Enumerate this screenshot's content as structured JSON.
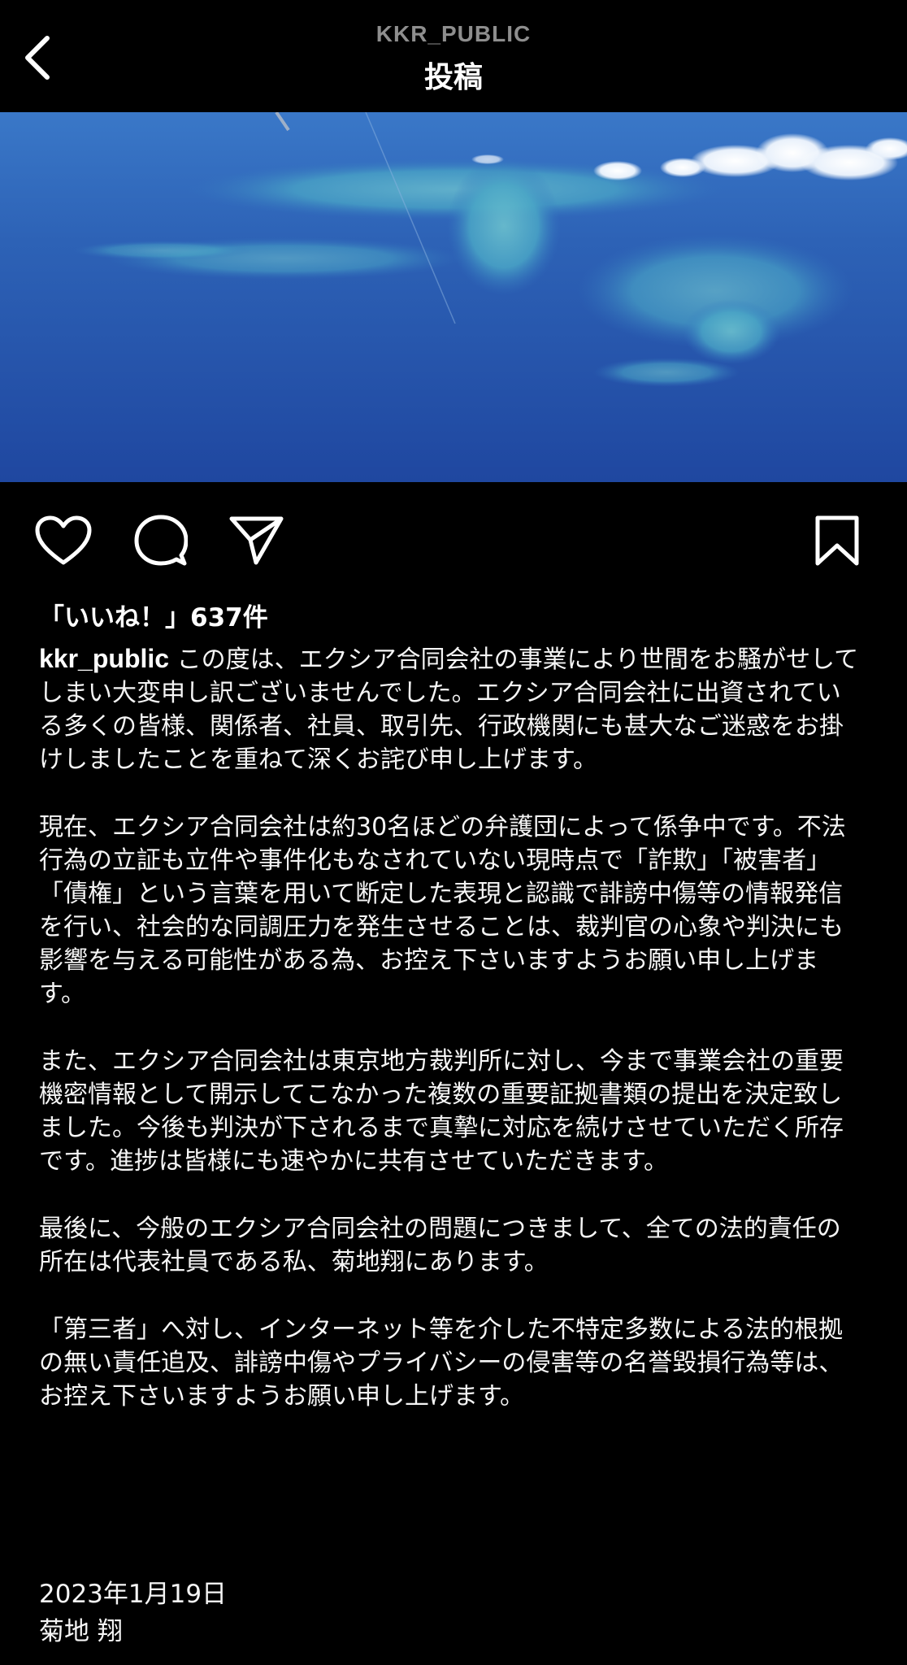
{
  "header": {
    "back_icon": "chevron-left-icon",
    "username": "KKR_PUBLIC",
    "title": "投稿"
  },
  "post": {
    "image_description_icon": "photo",
    "actions": {
      "like_icon": "heart-icon",
      "comment_icon": "comment-icon",
      "share_icon": "paper-plane-icon",
      "save_icon": "bookmark-icon"
    },
    "likes_text": "「いいね！」637件",
    "caption_user": "kkr_public",
    "caption_paragraphs": [
      "この度は、エクシア合同会社の事業により世間をお騒がせしてしまい大変申し訳ございませんでした。エクシア合同会社に出資されている多くの皆様、関係者、社員、取引先、行政機関にも甚大なご迷惑をお掛けしましたことを重ねて深くお詫び申し上げます。",
      "現在、エクシア合同会社は約30名ほどの弁護団によって係争中です。不法行為の立証も立件や事件化もなされていない現時点で「詐欺」「被害者」「債権」という言葉を用いて断定した表現と認識で誹謗中傷等の情報発信を行い、社会的な同調圧力を発生させることは、裁判官の心象や判決にも影響を与える可能性がある為、お控え下さいますようお願い申し上げます。",
      "また、エクシア合同会社は東京地方裁判所に対し、今まで事業会社の重要機密情報として開示してこなかった複数の重要証拠書類の提出を決定致しました。今後も判決が下されるまで真摯に対応を続けさせていただく所存です。進捗は皆様にも速やかに共有させていただきます。",
      "最後に、今般のエクシア合同会社の問題につきまして、全ての法的責任の所在は代表社員である私、菊地翔にあります。",
      "「第三者」へ対し、インターネット等を介した不特定多数による法的根拠の無い責任追及、誹謗中傷やプライバシーの侵害等の名誉毀損行為等は、お控え下さいますようお願い申し上げます。"
    ],
    "date": "2023年1月19日",
    "signature": "菊地 翔"
  }
}
